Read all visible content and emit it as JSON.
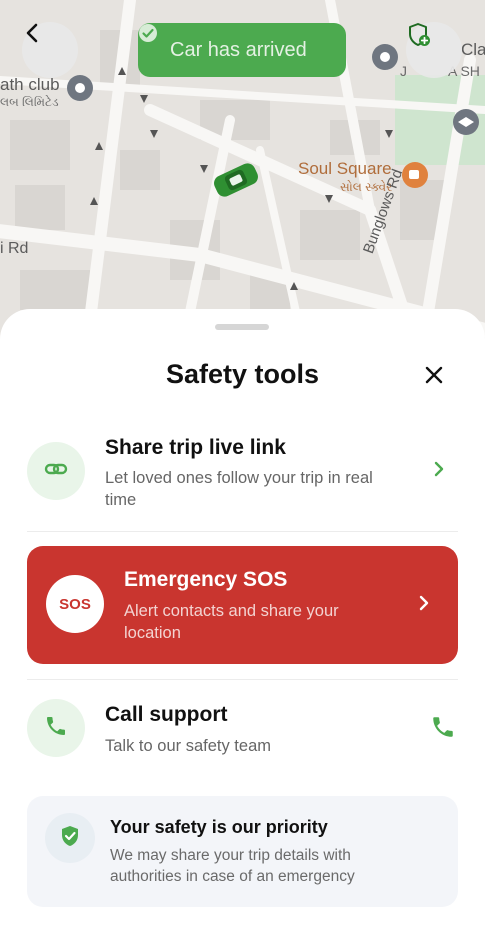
{
  "map": {
    "labels": {
      "place_left": "ath club",
      "place_left_sub": "લબ લિમિટેડ",
      "road_left": "i Rd",
      "poi_name": "Soul Square",
      "poi_sub": "સોલ સ્ક્વેર",
      "road_right": "Bunglows Rd",
      "place_right": "Cla",
      "place_right_sub": "J",
      "place_right_sub2": "A SH"
    }
  },
  "header": {
    "back_icon": "chevron-left-icon",
    "status_label": "Car has arrived",
    "status_icon": "check-circle-icon",
    "safety_icon": "shield-plus-icon"
  },
  "sheet": {
    "title": "Safety tools",
    "close_icon": "close-icon",
    "items": [
      {
        "title": "Share trip live link",
        "subtitle_line1": "Let loved ones follow your trip in real",
        "subtitle_line2": "time",
        "icon": "link-icon"
      },
      {
        "title": "Emergency SOS",
        "subtitle_line1": "Alert contacts and share your",
        "subtitle_line2": "location",
        "badge": "SOS"
      },
      {
        "title": "Call support",
        "subtitle_line1": "Talk to our safety team",
        "icon": "phone-icon"
      }
    ],
    "info": {
      "title": "Your safety is our priority",
      "line1": "We may share your trip details with",
      "line2": "authorities in case of an emergency"
    }
  },
  "colors": {
    "brand_green": "#4caa4f",
    "sos_red": "#c9352f",
    "map_base": "#e6e3df"
  }
}
